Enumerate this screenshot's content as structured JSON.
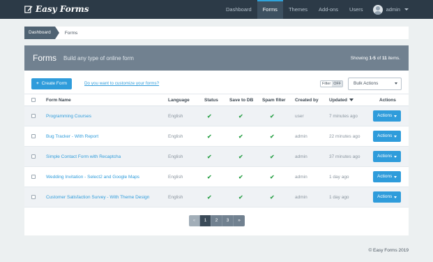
{
  "brand": {
    "name": "Easy Forms",
    "icon": "edit-icon"
  },
  "nav": {
    "items": [
      {
        "label": "Dashboard",
        "active": false
      },
      {
        "label": "Forms",
        "active": true
      },
      {
        "label": "Themes",
        "active": false
      },
      {
        "label": "Add-ons",
        "active": false
      },
      {
        "label": "Users",
        "active": false
      }
    ],
    "user": {
      "name": "admin",
      "icon": "avatar-icon"
    }
  },
  "breadcrumb": {
    "home": "Dashboard",
    "current": "Forms"
  },
  "panel": {
    "title": "Forms",
    "subtitle": "Build any type of online form",
    "showing_prefix": "Showing ",
    "showing_range": "1-5",
    "showing_mid": " of ",
    "showing_total": "11",
    "showing_suffix": " items."
  },
  "toolbar": {
    "create_label": "Create Form",
    "customize_link": "Do you want to customize your forms?",
    "filter_label": "Filter",
    "filter_state": "OFF",
    "bulk_label": "Bulk Actions"
  },
  "table": {
    "headers": {
      "name": "Form Name",
      "language": "Language",
      "status": "Status",
      "save_db": "Save to DB",
      "spam": "Spam filter",
      "created_by": "Created by",
      "updated": "Updated",
      "actions": "Actions"
    },
    "rows": [
      {
        "name": "Programming Courses",
        "language": "English",
        "created_by": "user",
        "updated": "7 minutes ago",
        "action": "Actions"
      },
      {
        "name": "Bug Tracker - With Report",
        "language": "English",
        "created_by": "admin",
        "updated": "22 minutes ago",
        "action": "Actions"
      },
      {
        "name": "Simple Contact Form with Recaptcha",
        "language": "English",
        "created_by": "admin",
        "updated": "37 minutes ago",
        "action": "Actions"
      },
      {
        "name": "Wedding Invitation - Select2 and Google Maps",
        "language": "English",
        "created_by": "admin",
        "updated": "1 day ago",
        "action": "Actions"
      },
      {
        "name": "Customer Satisfaction Survey - With Theme Design",
        "language": "English",
        "created_by": "admin",
        "updated": "1 day ago",
        "action": "Actions"
      }
    ],
    "check_glyph": "✔"
  },
  "pagination": {
    "prev": "«",
    "pages": [
      "1",
      "2",
      "3"
    ],
    "next": "»",
    "active": "1"
  },
  "footer": {
    "text": "© Easy Forms 2019"
  },
  "colors": {
    "navbar": "#2c3a47",
    "accent": "#2f9cdb",
    "panel_head": "#718190",
    "check": "#2ea24b"
  }
}
